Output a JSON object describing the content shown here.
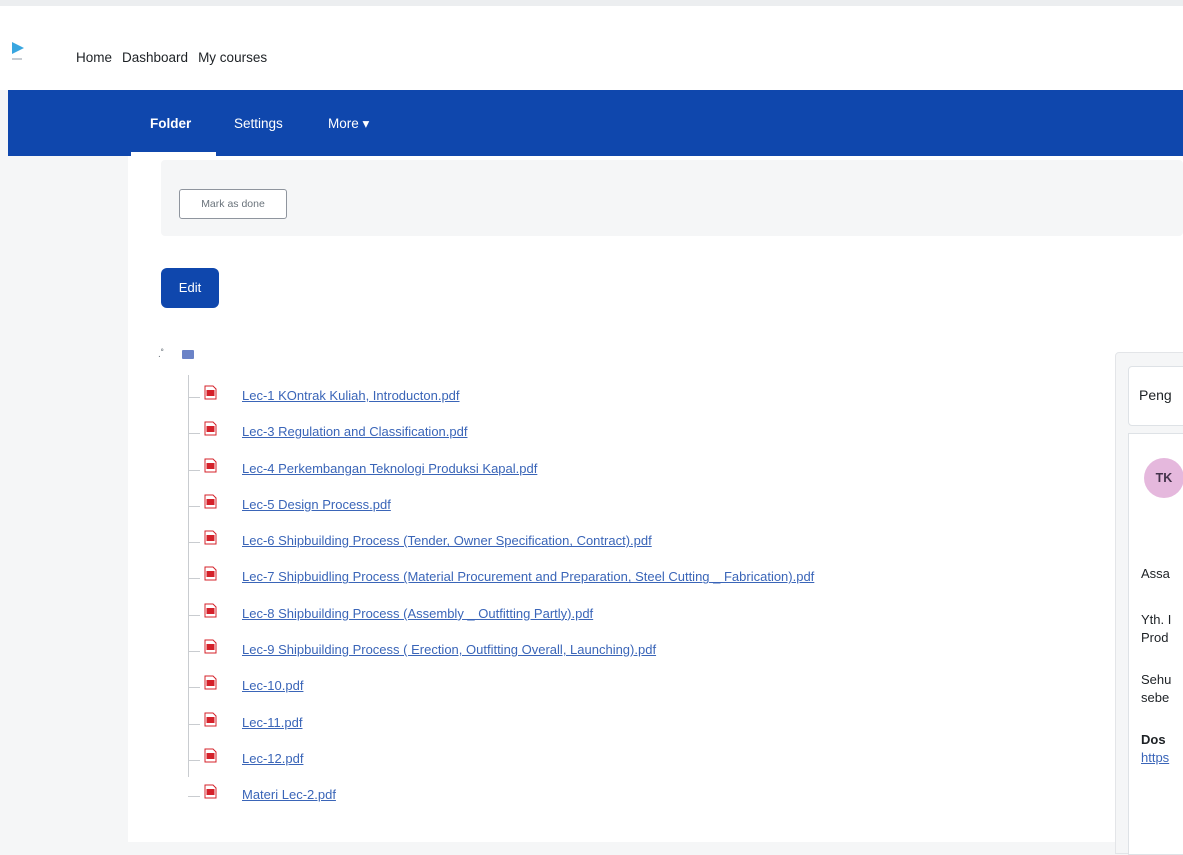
{
  "topnav": {
    "items": [
      "Home",
      "Dashboard",
      "My courses"
    ]
  },
  "secondary_nav": {
    "tabs": [
      {
        "label": "Folder",
        "active": true
      },
      {
        "label": "Settings",
        "active": false
      },
      {
        "label": "More ▾",
        "active": false
      }
    ]
  },
  "completion": {
    "mark_done_label": "Mark as done"
  },
  "actions": {
    "edit_label": "Edit"
  },
  "files": [
    "Lec-1 KOntrak Kuliah, Introducton.pdf",
    "Lec-3 Regulation and Classification.pdf",
    "Lec-4 Perkembangan Teknologi Produksi Kapal.pdf",
    "Lec-5 Design Process.pdf",
    "Lec-6 Shipbuilding Process (Tender, Owner Specification, Contract).pdf",
    "Lec-7 Shipbuidling Process (Material Procurement and Preparation, Steel Cutting _ Fabrication).pdf",
    "Lec-8 Shipbuilding Process (Assembly _ Outfitting Partly).pdf",
    "Lec-9 Shipbuilding Process ( Erection, Outfitting Overall, Launching).pdf",
    "Lec-10.pdf",
    "Lec-11.pdf",
    "Lec-12.pdf",
    "Materi Lec-2.pdf"
  ],
  "side_panel": {
    "title": "Peng",
    "avatar_initials": "TK",
    "lines": [
      "Assa",
      "Yth. I",
      "Prod",
      "Sehu",
      "sebe",
      "Dos",
      "https"
    ]
  },
  "colors": {
    "primary": "#0f47ad",
    "link": "#3a65b8",
    "pdf_red": "#d4212a"
  }
}
